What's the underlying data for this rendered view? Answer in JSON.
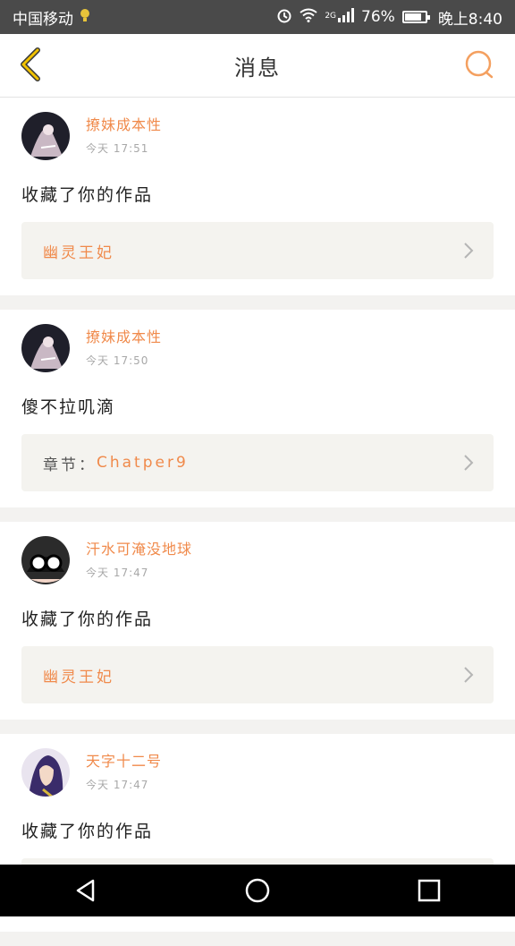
{
  "status_bar": {
    "carrier": "中国移动",
    "network": "2G",
    "battery": "76%",
    "time": "晚上8:40"
  },
  "header": {
    "title": "消息"
  },
  "messages": [
    {
      "user": "撩妹成本性",
      "time": "今天 17:51",
      "text": "收藏了你的作品",
      "ref_label": "",
      "ref_title": "幽灵王妃"
    },
    {
      "user": "撩妹成本性",
      "time": "今天 17:50",
      "text": "傻不拉叽滴",
      "ref_label": "章节：",
      "ref_title": "Chatper9"
    },
    {
      "user": "汗水可淹没地球",
      "time": "今天 17:47",
      "text": "收藏了你的作品",
      "ref_label": "",
      "ref_title": "幽灵王妃"
    },
    {
      "user": "天字十二号",
      "time": "今天 17:47",
      "text": "收藏了你的作品",
      "ref_label": "",
      "ref_title": ""
    }
  ],
  "colors": {
    "accent": "#f08a4b",
    "header_back": "#f2c200",
    "search": "#f4a060"
  },
  "icons": {
    "back": "chevron-left-icon",
    "search": "search-icon",
    "chevron": "chevron-right-icon"
  }
}
